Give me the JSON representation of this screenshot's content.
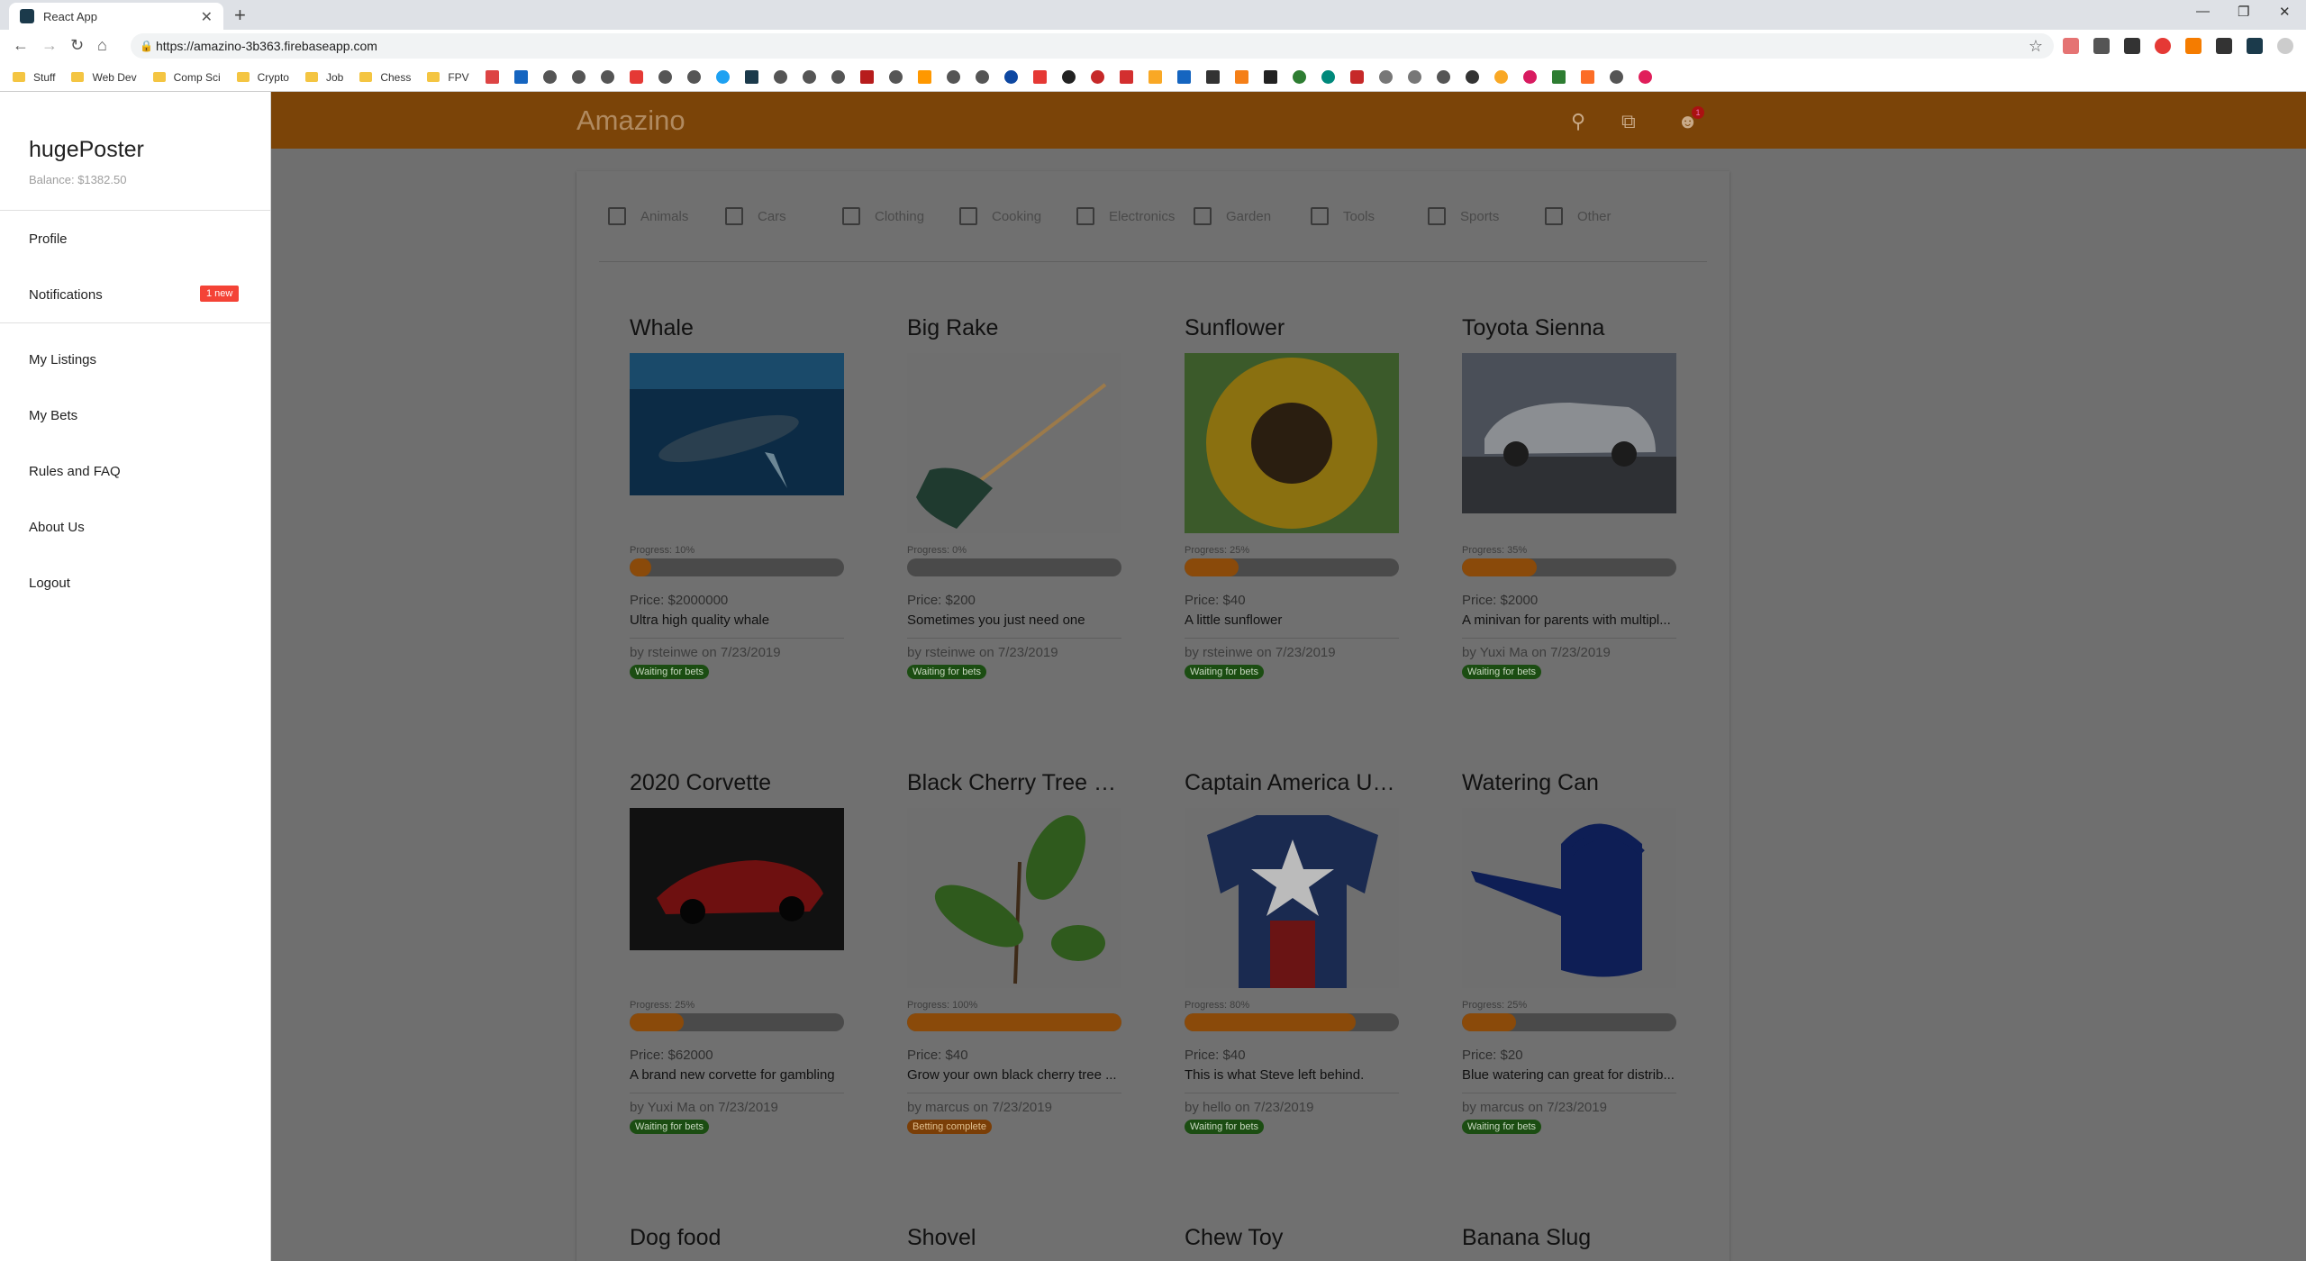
{
  "browser": {
    "tab_title": "React App",
    "tab_close": "✕",
    "new_tab": "+",
    "url": "https://amazino-3b363.firebaseapp.com",
    "bookmark_folders": [
      "Stuff",
      "Web Dev",
      "Comp Sci",
      "Crypto",
      "Job",
      "Chess",
      "FPV"
    ]
  },
  "app": {
    "title": "Amazino"
  },
  "drawer": {
    "user_name": "hugePoster",
    "balance": "Balance: $1382.50",
    "items": {
      "profile": "Profile",
      "notifications": "Notifications",
      "notifications_badge": "1 new",
      "my_listings": "My Listings",
      "my_bets": "My Bets",
      "rules": "Rules and FAQ",
      "about": "About Us",
      "logout": "Logout"
    }
  },
  "appbar": {
    "notification_count": "1"
  },
  "filters": [
    "Animals",
    "Cars",
    "Clothing",
    "Cooking",
    "Electronics",
    "Garden",
    "Tools",
    "Sports",
    "Other"
  ],
  "listings": [
    {
      "title": "Whale",
      "progress_label": "Progress: 10%",
      "progress": 0.1,
      "price": "Price: $2000000",
      "desc": "Ultra high quality whale",
      "by": "by rsteinwe on 7/23/2019",
      "status": "Waiting for bets"
    },
    {
      "title": "Big Rake",
      "progress_label": "Progress: 0%",
      "progress": 0.0,
      "price": "Price: $200",
      "desc": "Sometimes you just need one",
      "by": "by rsteinwe on 7/23/2019",
      "status": "Waiting for bets"
    },
    {
      "title": "Sunflower",
      "progress_label": "Progress: 25%",
      "progress": 0.25,
      "price": "Price: $40",
      "desc": "A little sunflower",
      "by": "by rsteinwe on 7/23/2019",
      "status": "Waiting for bets"
    },
    {
      "title": "Toyota Sienna",
      "progress_label": "Progress: 35%",
      "progress": 0.35,
      "price": "Price: $2000",
      "desc": "A minivan for parents with multipl...",
      "by": "by Yuxi Ma on 7/23/2019",
      "status": "Waiting for bets"
    },
    {
      "title": "2020 Corvette",
      "progress_label": "Progress: 25%",
      "progress": 0.25,
      "price": "Price: $62000",
      "desc": "A brand new corvette for gambling",
      "by": "by Yuxi Ma on 7/23/2019",
      "status": "Waiting for bets"
    },
    {
      "title": "Black Cherry Tree Sa...",
      "progress_label": "Progress: 100%",
      "progress": 1.0,
      "price": "Price: $40",
      "desc": "Grow your own black cherry tree ...",
      "by": "by marcus on 7/23/2019",
      "status": "Betting complete"
    },
    {
      "title": "Captain America Un...",
      "progress_label": "Progress: 80%",
      "progress": 0.8,
      "price": "Price: $40",
      "desc": "This is what Steve left behind.",
      "by": "by hello on 7/23/2019",
      "status": "Waiting for bets"
    },
    {
      "title": "Watering Can",
      "progress_label": "Progress: 25%",
      "progress": 0.25,
      "price": "Price: $20",
      "desc": "Blue watering can great for distrib...",
      "by": "by marcus on 7/23/2019",
      "status": "Waiting for bets"
    },
    {
      "title": "Dog food"
    },
    {
      "title": "Shovel"
    },
    {
      "title": "Chew Toy"
    },
    {
      "title": "Banana Slug"
    }
  ]
}
